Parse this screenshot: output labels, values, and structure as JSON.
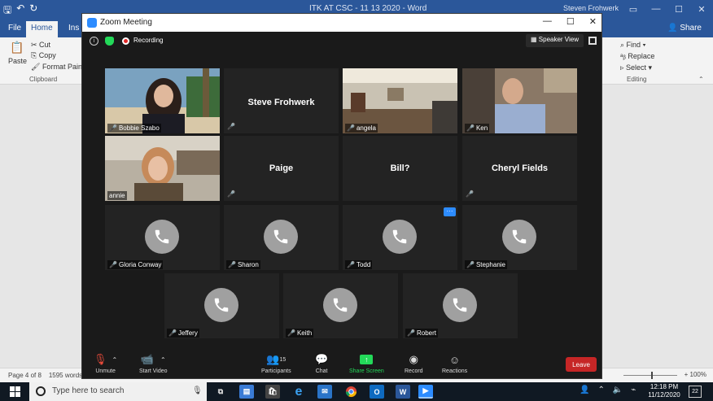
{
  "word": {
    "doc_title": "ITK AT CSC - 11 13 2020  -  Word",
    "user": "Steven Frohwerk",
    "tabs": [
      "File",
      "Home",
      "Ins"
    ],
    "share_label": "Share",
    "clipboard": {
      "cut": "Cut",
      "copy": "Copy",
      "paste": "Paste",
      "format_painter": "Format Painter",
      "group": "Clipboard"
    },
    "editing": {
      "find": "Find",
      "replace": "Replace",
      "select": "Select",
      "group": "Editing"
    },
    "status": {
      "page": "Page 4 of 8",
      "words": "1595 words",
      "zoom": "100%"
    }
  },
  "zoom": {
    "window_title": "Zoom Meeting",
    "recording": "Recording",
    "speaker_view": "Speaker View",
    "participants": [
      {
        "name": "Bobbie Szabo",
        "kind": "video"
      },
      {
        "name": "Steve Frohwerk",
        "kind": "name"
      },
      {
        "name": "angela",
        "kind": "video"
      },
      {
        "name": "Ken",
        "kind": "video"
      },
      {
        "name": "annie",
        "kind": "video"
      },
      {
        "name": "Paige",
        "kind": "name"
      },
      {
        "name": "Bill?",
        "kind": "name"
      },
      {
        "name": "Cheryl Fields",
        "kind": "name"
      },
      {
        "name": "Gloria Conway",
        "kind": "phone"
      },
      {
        "name": "Sharon",
        "kind": "phone"
      },
      {
        "name": "Todd",
        "kind": "phone"
      },
      {
        "name": "Stephanie",
        "kind": "phone"
      },
      {
        "name": "Jeffery",
        "kind": "phone"
      },
      {
        "name": "Keith",
        "kind": "phone"
      },
      {
        "name": "Robert",
        "kind": "phone"
      }
    ],
    "more_label": "···",
    "toolbar": {
      "unmute": "Unmute",
      "start_video": "Start Video",
      "participants": "Participants",
      "participants_count": "15",
      "chat": "Chat",
      "share_screen": "Share Screen",
      "record": "Record",
      "reactions": "Reactions",
      "leave": "Leave"
    }
  },
  "taskbar": {
    "search_placeholder": "Type here to search",
    "time": "12:18 PM",
    "date": "11/12/2020",
    "notifications": "22"
  },
  "colors": {
    "word_blue": "#2b579a",
    "zoom_blue": "#2d8cff",
    "leave_red": "#c62626",
    "share_green": "#23d959",
    "active_speaker": "#c7e01a"
  }
}
